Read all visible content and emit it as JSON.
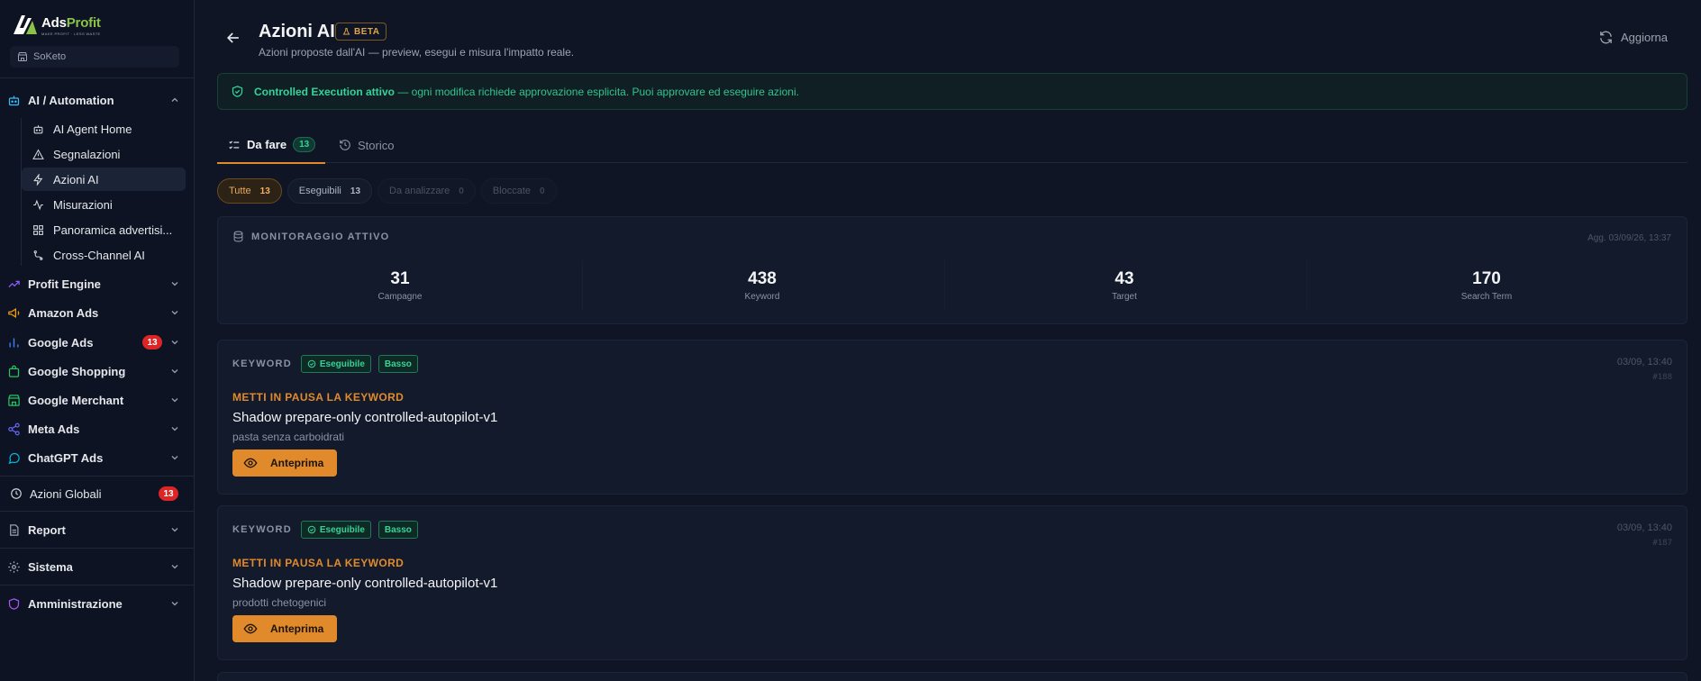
{
  "app": {
    "name_main": "Ads",
    "name_accent": "Profit",
    "tagline": "MAKE PROFIT · LESS WASTE"
  },
  "workspace": {
    "name": "SoKeto"
  },
  "sidebar": {
    "ai_automation": {
      "label": "AI / Automation",
      "items": [
        {
          "label": "AI Agent Home",
          "icon": "robot-icon"
        },
        {
          "label": "Segnalazioni",
          "icon": "warning-icon"
        },
        {
          "label": "Azioni AI",
          "icon": "bolt-icon",
          "active": true
        },
        {
          "label": "Misurazioni",
          "icon": "activity-icon"
        },
        {
          "label": "Panoramica advertisi...",
          "icon": "dashboard-icon"
        },
        {
          "label": "Cross-Channel AI",
          "icon": "route-icon"
        }
      ]
    },
    "sections": [
      {
        "label": "Profit Engine",
        "icon": "trending-up-icon",
        "color": "#8b5cf6"
      },
      {
        "label": "Amazon Ads",
        "icon": "megaphone-icon",
        "color": "#f59e0b"
      },
      {
        "label": "Google Ads",
        "icon": "bar-chart-icon",
        "color": "#3b82f6",
        "badge": "13"
      },
      {
        "label": "Google Shopping",
        "icon": "shopping-bag-icon",
        "color": "#22c55e"
      },
      {
        "label": "Google Merchant",
        "icon": "store-icon",
        "color": "#22c55e"
      },
      {
        "label": "Meta Ads",
        "icon": "share-icon",
        "color": "#6366f1"
      },
      {
        "label": "ChatGPT Ads",
        "icon": "chat-icon",
        "color": "#06b6d4"
      }
    ],
    "global_actions": {
      "label": "Azioni Globali",
      "badge": "13"
    },
    "report": {
      "label": "Report"
    },
    "system": {
      "label": "Sistema"
    },
    "admin": {
      "label": "Amministrazione"
    }
  },
  "header": {
    "title": "Azioni AI",
    "beta": "BETA",
    "subtitle": "Azioni proposte dall'AI — preview, esegui e misura l'impatto reale.",
    "refresh_label": "Aggiorna"
  },
  "banner": {
    "strong": "Controlled Execution attivo",
    "text": " — ogni modifica richiede approvazione esplicita. Puoi approvare ed eseguire azioni."
  },
  "tabs": [
    {
      "label": "Da fare",
      "count": "13"
    },
    {
      "label": "Storico"
    }
  ],
  "filters": [
    {
      "label": "Tutte",
      "count": "13"
    },
    {
      "label": "Eseguibili",
      "count": "13"
    },
    {
      "label": "Da analizzare",
      "count": "0"
    },
    {
      "label": "Bloccate",
      "count": "0"
    }
  ],
  "monitoring": {
    "title": "MONITORAGGIO ATTIVO",
    "updated": "Agg. 03/09/26, 13:37",
    "stats": [
      {
        "value": "31",
        "label": "Campagne"
      },
      {
        "value": "438",
        "label": "Keyword"
      },
      {
        "value": "43",
        "label": "Target"
      },
      {
        "value": "170",
        "label": "Search Term"
      }
    ]
  },
  "actions": [
    {
      "entity": "KEYWORD",
      "status": "Eseguibile",
      "risk": "Basso",
      "date": "03/09, 13:40",
      "id": "#188",
      "type": "METTI IN PAUSA LA KEYWORD",
      "title": "Shadow prepare-only controlled-autopilot-v1",
      "target": "pasta senza carboidrati",
      "button": "Anteprima"
    },
    {
      "entity": "KEYWORD",
      "status": "Eseguibile",
      "risk": "Basso",
      "date": "03/09, 13:40",
      "id": "#187",
      "type": "METTI IN PAUSA LA KEYWORD",
      "title": "Shadow prepare-only controlled-autopilot-v1",
      "target": "prodotti chetogenici",
      "button": "Anteprima"
    }
  ]
}
